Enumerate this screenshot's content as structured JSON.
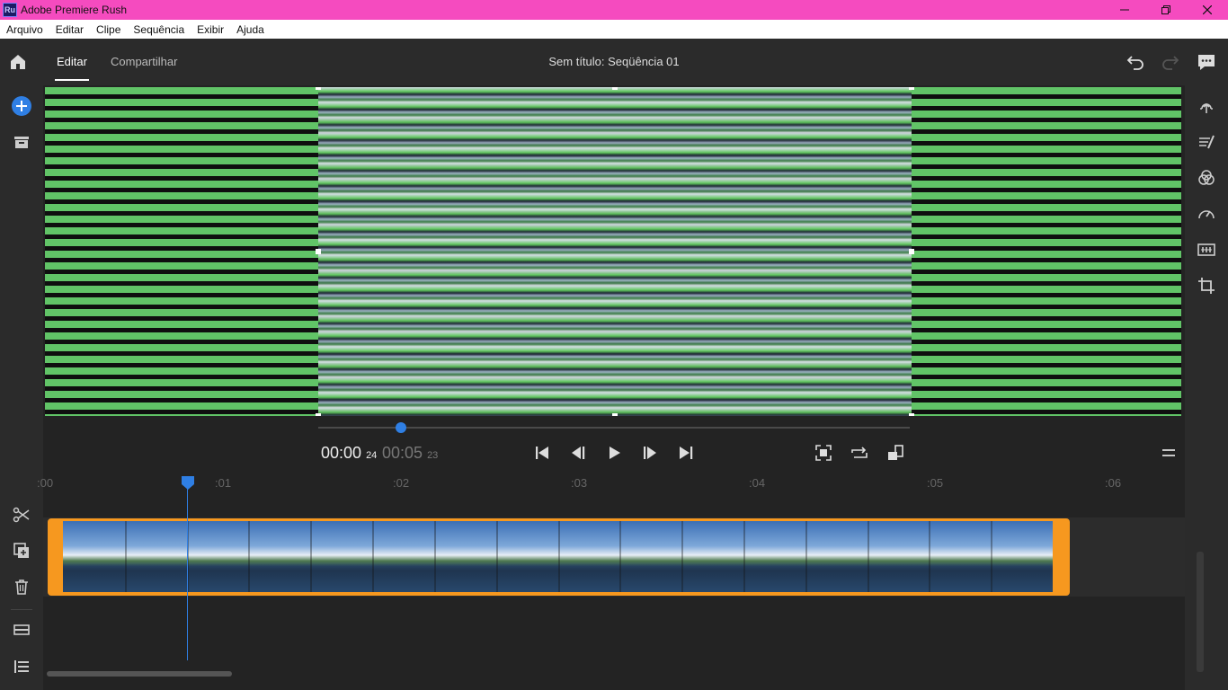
{
  "window": {
    "app_icon_text": "Ru",
    "title": "Adobe Premiere Rush",
    "controls": [
      "minimize-icon",
      "restore-icon",
      "close-icon"
    ]
  },
  "menu": {
    "items": [
      "Arquivo",
      "Editar",
      "Clipe",
      "Sequência",
      "Exibir",
      "Ajuda"
    ]
  },
  "header": {
    "tabs": [
      {
        "label": "Editar",
        "active": true
      },
      {
        "label": "Compartilhar",
        "active": false
      }
    ],
    "sequence_title": "Sem título: Seqüência 01",
    "right_icons": [
      "undo-icon",
      "redo-icon",
      "comments-icon"
    ]
  },
  "left_toolbar": {
    "top_icons": [
      "add-media-icon",
      "project-bin-icon"
    ],
    "bottom_icons": [
      "scissors-icon",
      "duplicate-icon",
      "trash-icon",
      "track-controls-icon",
      "track-list-icon"
    ]
  },
  "right_toolbar": {
    "icons": [
      "titles-icon",
      "transitions-icon",
      "color-icon",
      "speed-icon",
      "audio-icon",
      "transform-icon"
    ]
  },
  "player": {
    "current_time": "00:00",
    "current_frames": "24",
    "duration_time": "00:05",
    "duration_frames": "23",
    "scrub_progress": 0.14,
    "controls": [
      "skip-to-start-icon",
      "step-back-icon",
      "play-icon",
      "step-forward-icon",
      "skip-to-end-icon"
    ],
    "right_controls": [
      "fit-frame-icon",
      "loop-icon",
      "aspect-ratio-icon"
    ],
    "menu_icon": "hamburger-icon"
  },
  "timeline": {
    "ruler_labels": [
      ":00",
      ":01",
      ":02",
      ":03",
      ":04",
      ":05",
      ":06"
    ],
    "playhead_time_seconds": 0.8,
    "clip": {
      "thumbnail_count": 16
    },
    "colors": {
      "clip_border": "#f6981f",
      "playhead": "#2f7fe4",
      "accent": "#2f7fe4"
    }
  },
  "colors": {
    "title_bar": "#f54bbf",
    "preview_stripe": "#61c467"
  }
}
